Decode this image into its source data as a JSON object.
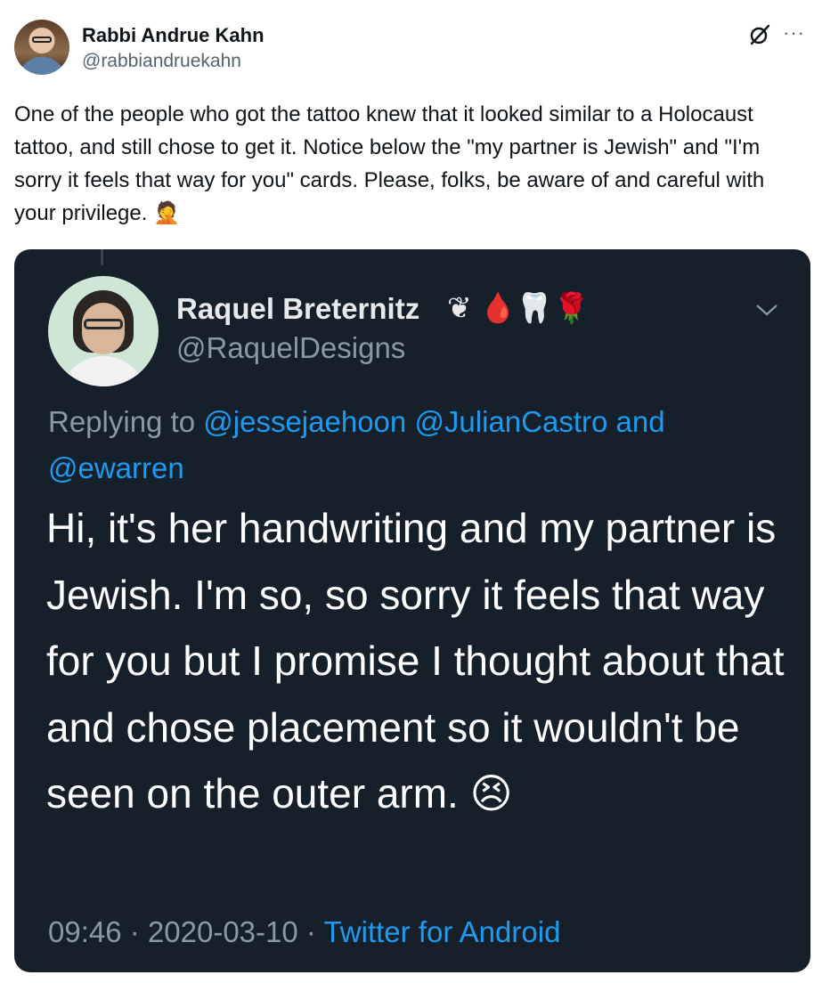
{
  "post": {
    "author": {
      "name": "Rabbi Andrue Kahn",
      "handle": "@rabbiandruekahn"
    },
    "text": "One of the people who got the tattoo knew that it looked similar to a Holocaust tattoo, and still chose to get it. Notice below the \"my partner is Jewish\"  and \"I'm sorry it feels that way for you\" cards. Please, folks, be aware of and careful with your privilege. 🤦",
    "more_label": "···",
    "icons": {
      "grok": "grok-icon",
      "more": "more-icon"
    }
  },
  "quoted": {
    "author": {
      "name": "Raquel Breternitz",
      "emojis": "❦ 🩸🦷🌹",
      "handle": "@RaquelDesigns"
    },
    "replying_prefix": "Replying to ",
    "mentions": [
      "@jessejaehoon",
      "@JulianCastro"
    ],
    "and_text": " and ",
    "last_mention": "@ewarren",
    "body": "Hi, it's her handwriting and my partner is Jewish. I'm so, so sorry it feels that way for you but I promise I thought about that and chose placement so it wouldn't be seen on the outer arm. 😣",
    "time": "09:46",
    "date": "2020-03-10",
    "separator": " · ",
    "source": "Twitter for Android",
    "colors": {
      "background": "#15202b",
      "link": "#1d9bf0",
      "muted": "#8b98a5"
    }
  }
}
